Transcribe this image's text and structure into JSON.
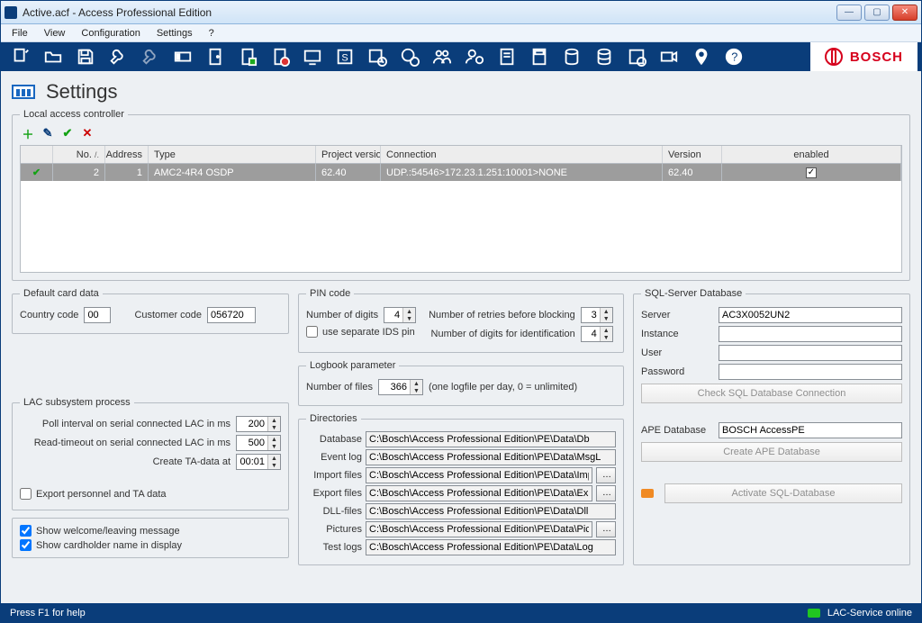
{
  "window": {
    "title": "Active.acf - Access Professional Edition"
  },
  "menubar": [
    "File",
    "View",
    "Configuration",
    "Settings",
    "?"
  ],
  "brand": "BOSCH",
  "page": {
    "title": "Settings"
  },
  "lac_table": {
    "title": "Local access controller",
    "headers": {
      "no": "No.",
      "sort": "/.",
      "address": "Address",
      "type": "Type",
      "project_version": "Project version",
      "connection": "Connection",
      "version": "Version",
      "enabled": "enabled"
    },
    "rows": [
      {
        "no": "2",
        "address": "1",
        "type": "AMC2-4R4  OSDP",
        "project_version": "62.40",
        "connection": "UDP.:54546>172.23.1.251:10001>NONE",
        "version": "62.40",
        "enabled": true
      }
    ]
  },
  "default_card": {
    "title": "Default card data",
    "country_label": "Country code",
    "country_value": "00",
    "customer_label": "Customer code",
    "customer_value": "056720"
  },
  "lac_process": {
    "title": "LAC subsystem process",
    "poll_label": "Poll interval on serial connected LAC in ms",
    "poll_value": "200",
    "read_label": "Read-timeout on serial connected LAC in ms",
    "read_value": "500",
    "ta_label": "Create TA-data at",
    "ta_value": "00:01",
    "export_label": "Export personnel and TA data"
  },
  "display_opts": {
    "welcome_label": "Show welcome/leaving message",
    "cardholder_label": "Show cardholder name in display"
  },
  "pin": {
    "title": "PIN code",
    "digits_label": "Number of digits",
    "digits_value": "4",
    "retries_label": "Number of retries before blocking",
    "retries_value": "3",
    "ids_label": "use separate IDS pin",
    "id_digits_label": "Number of digits for identification",
    "id_digits_value": "4"
  },
  "logbook": {
    "title": "Logbook parameter",
    "files_label": "Number of  files",
    "files_value": "366",
    "hint": "(one logfile per day, 0 = unlimited)"
  },
  "directories": {
    "title": "Directories",
    "labels": {
      "db": "Database",
      "event": "Event log",
      "import": "Import files",
      "export": "Export files",
      "dll": "DLL-files",
      "pictures": "Pictures",
      "test": "Test logs"
    },
    "values": {
      "db": "C:\\Bosch\\Access Professional Edition\\PE\\Data\\Db",
      "event": "C:\\Bosch\\Access Professional Edition\\PE\\Data\\MsgL",
      "import": "C:\\Bosch\\Access Professional Edition\\PE\\Data\\Impo",
      "export": "C:\\Bosch\\Access Professional Edition\\PE\\Data\\Expo",
      "dll": "C:\\Bosch\\Access Professional Edition\\PE\\Data\\Dll",
      "pictures": "C:\\Bosch\\Access Professional Edition\\PE\\Data\\Pictu",
      "test": "C:\\Bosch\\Access Professional Edition\\PE\\Data\\Log"
    }
  },
  "sql": {
    "title": "SQL-Server Database",
    "server_label": "Server",
    "server_value": "AC3X0052UN2",
    "instance_label": "Instance",
    "instance_value": "",
    "user_label": "User",
    "user_value": "",
    "password_label": "Password",
    "password_value": "",
    "check_btn": "Check SQL Database Connection",
    "ape_label": "APE Database",
    "ape_value": "BOSCH AccessPE",
    "create_btn": "Create APE Database",
    "activate_btn": "Activate SQL-Database"
  },
  "status": {
    "help": "Press F1 for help",
    "service": "LAC-Service online"
  }
}
